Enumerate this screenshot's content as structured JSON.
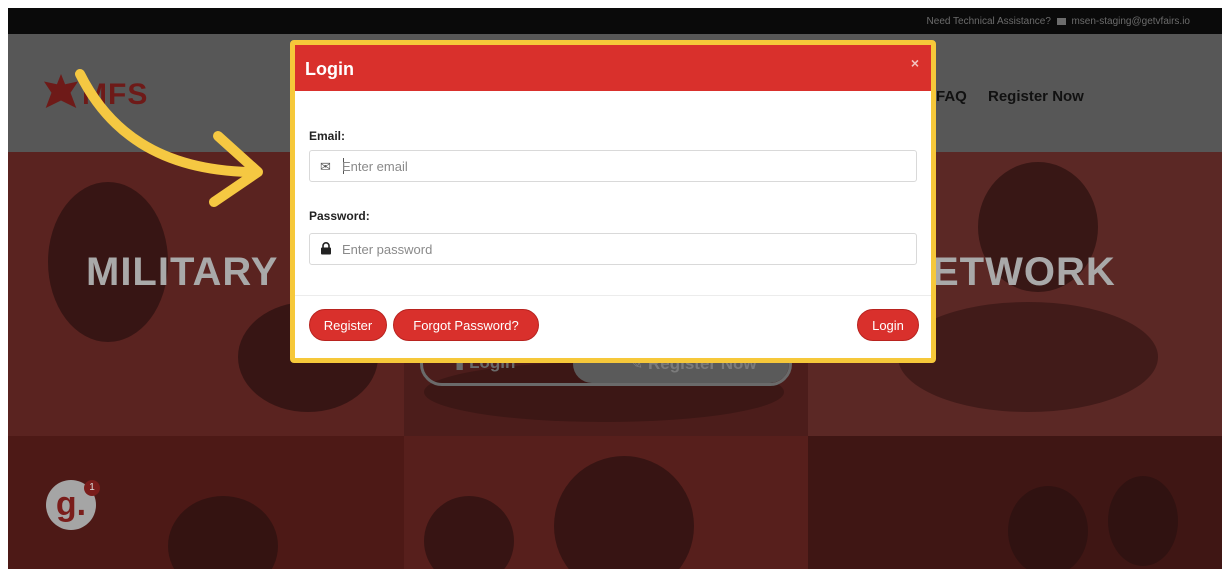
{
  "topbar": {
    "assistance_text": "Need Technical Assistance?",
    "email": "msen-staging@getvfairs.io"
  },
  "brand": {
    "name": "MFS"
  },
  "nav": {
    "faq": "FAQ",
    "register_now": "Register Now"
  },
  "hero": {
    "title_left": "MILITARY",
    "title_right": "ETWORK",
    "login_button": "Login",
    "register_button": "Register Now"
  },
  "badge": {
    "letter": "g.",
    "count": "1"
  },
  "modal": {
    "title": "Login",
    "close": "×",
    "email_label": "Email:",
    "email_placeholder": "Enter email",
    "password_label": "Password:",
    "password_placeholder": "Enter password",
    "register_button": "Register",
    "forgot_button": "Forgot Password?",
    "login_button": "Login"
  },
  "colors": {
    "accent_red": "#d9302c",
    "highlight_yellow": "#f6c83a",
    "annotation_arrow": "#f5c842"
  }
}
